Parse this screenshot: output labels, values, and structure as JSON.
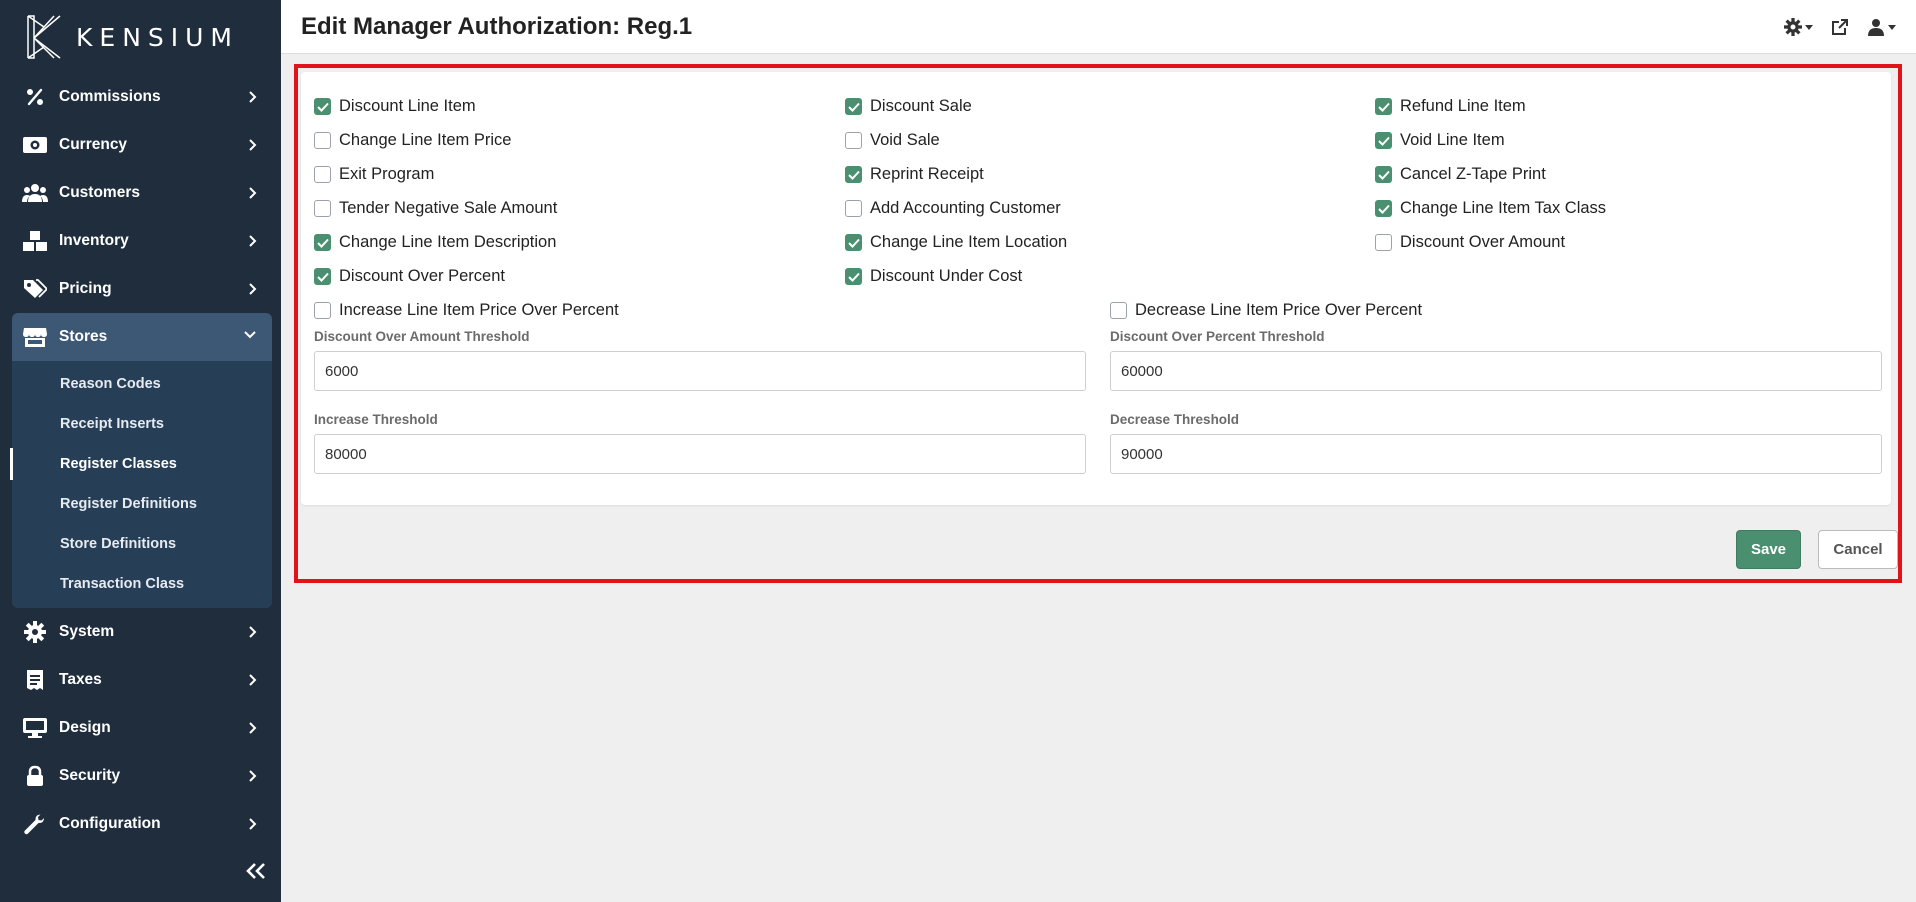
{
  "brand": {
    "name": "KENSIUM"
  },
  "colors": {
    "sidebar": "#1f2d3d",
    "accent": "#4a8f6f",
    "highlight": "#e0131a"
  },
  "page_title": "Edit Manager Authorization: Reg.1",
  "header_icons": [
    "settings-gear-icon",
    "external-link-icon",
    "user-icon"
  ],
  "sidebar": {
    "items": [
      {
        "label": "Commissions",
        "icon": "percent-icon"
      },
      {
        "label": "Currency",
        "icon": "money-icon"
      },
      {
        "label": "Customers",
        "icon": "users-icon"
      },
      {
        "label": "Inventory",
        "icon": "boxes-icon"
      },
      {
        "label": "Pricing",
        "icon": "tags-icon"
      },
      {
        "label": "Stores",
        "icon": "store-icon",
        "expanded": true
      },
      {
        "label": "System",
        "icon": "gear-icon"
      },
      {
        "label": "Taxes",
        "icon": "receipt-icon"
      },
      {
        "label": "Design",
        "icon": "monitor-icon"
      },
      {
        "label": "Security",
        "icon": "lock-icon"
      },
      {
        "label": "Configuration",
        "icon": "wrench-icon"
      }
    ],
    "stores_children": [
      {
        "label": "Reason Codes"
      },
      {
        "label": "Receipt Inserts"
      },
      {
        "label": "Register Classes",
        "current": true
      },
      {
        "label": "Register Definitions"
      },
      {
        "label": "Store Definitions"
      },
      {
        "label": "Transaction Class"
      }
    ]
  },
  "checkboxes": [
    {
      "label": "Discount Line Item",
      "checked": true
    },
    {
      "label": "Discount Sale",
      "checked": true
    },
    {
      "label": "Refund Line Item",
      "checked": true
    },
    {
      "label": "Change Line Item Price",
      "checked": false
    },
    {
      "label": "Void Sale",
      "checked": false
    },
    {
      "label": "Void Line Item",
      "checked": true
    },
    {
      "label": "Exit Program",
      "checked": false
    },
    {
      "label": "Reprint Receipt",
      "checked": true
    },
    {
      "label": "Cancel Z-Tape Print",
      "checked": true
    },
    {
      "label": "Tender Negative Sale Amount",
      "checked": false
    },
    {
      "label": "Add Accounting Customer",
      "checked": false
    },
    {
      "label": "Change Line Item Tax Class",
      "checked": true
    },
    {
      "label": "Change Line Item Description",
      "checked": true
    },
    {
      "label": "Change Line Item Location",
      "checked": true
    },
    {
      "label": "Discount Over Amount",
      "checked": false
    },
    {
      "label": "Discount Over Percent",
      "checked": true
    },
    {
      "label": "Discount Under Cost",
      "checked": true
    },
    {
      "label": "Increase Line Item Price Over Percent",
      "checked": false
    },
    {
      "label": "Decrease Line Item Price Over Percent",
      "checked": false
    }
  ],
  "fields": {
    "discount_over_amount_threshold": {
      "label": "Discount Over Amount Threshold",
      "value": "6000"
    },
    "discount_over_percent_threshold": {
      "label": "Discount Over Percent Threshold",
      "value": "60000"
    },
    "increase_threshold": {
      "label": "Increase Threshold",
      "value": "80000"
    },
    "decrease_threshold": {
      "label": "Decrease Threshold",
      "value": "90000"
    }
  },
  "buttons": {
    "save": "Save",
    "cancel": "Cancel"
  }
}
